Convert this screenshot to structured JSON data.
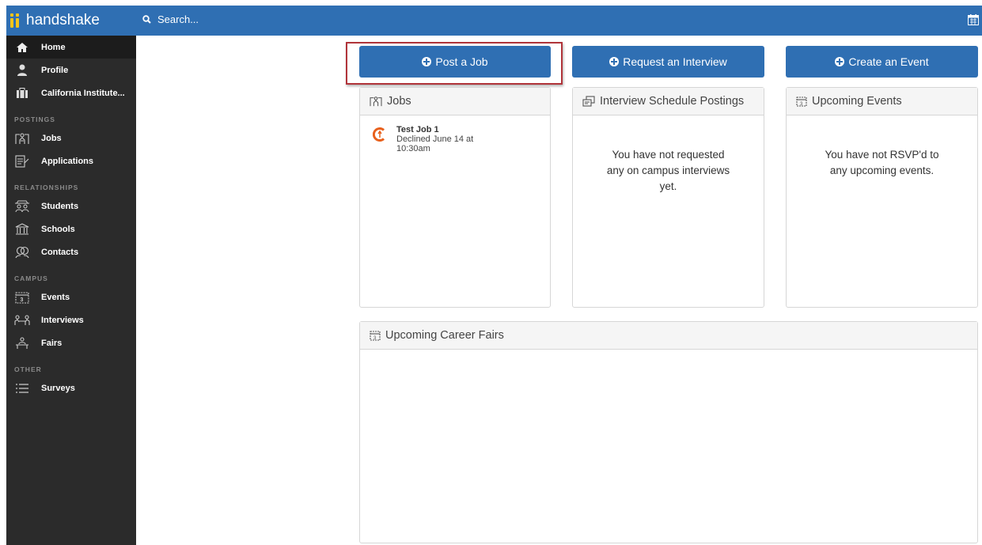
{
  "app": {
    "name": "handshake"
  },
  "search": {
    "placeholder": "Search..."
  },
  "sidebar": {
    "items_top": [
      {
        "label": "Home",
        "icon": "home-icon"
      },
      {
        "label": "Profile",
        "icon": "user-icon"
      },
      {
        "label": "California Institute...",
        "icon": "briefcase-icon"
      }
    ],
    "sections": {
      "postings": "POSTINGS",
      "relationships": "RELATIONSHIPS",
      "campus": "CAMPUS",
      "other": "OTHER"
    },
    "postings": [
      {
        "label": "Jobs",
        "icon": "jobs-icon"
      },
      {
        "label": "Applications",
        "icon": "applications-icon"
      }
    ],
    "relationships": [
      {
        "label": "Students",
        "icon": "students-icon"
      },
      {
        "label": "Schools",
        "icon": "school-icon"
      },
      {
        "label": "Contacts",
        "icon": "contacts-icon"
      }
    ],
    "campus": [
      {
        "label": "Events",
        "icon": "calendar-icon"
      },
      {
        "label": "Interviews",
        "icon": "interviews-icon"
      },
      {
        "label": "Fairs",
        "icon": "fairs-icon"
      }
    ],
    "other": [
      {
        "label": "Surveys",
        "icon": "surveys-icon"
      }
    ]
  },
  "actions": {
    "post_job": "Post a Job",
    "request_interview": "Request an Interview",
    "create_event": "Create an Event"
  },
  "cards": {
    "jobs": {
      "title": "Jobs",
      "job": {
        "title": "Test Job 1",
        "status": "Declined June 14 at 10:30am"
      }
    },
    "interviews": {
      "title": "Interview Schedule Postings",
      "empty_line1": "You have not requested",
      "empty_line2": "any on campus interviews",
      "empty_line3": "yet."
    },
    "events": {
      "title": "Upcoming Events",
      "empty_line1": "You have not RSVP'd to",
      "empty_line2": "any upcoming events."
    },
    "fairs": {
      "title": "Upcoming Career Fairs"
    }
  },
  "colors": {
    "brand_blue": "#2f6fb3",
    "sidebar_bg": "#2b2b2b",
    "logo_yellow": "#f5c518",
    "highlight_red": "#b0343a",
    "job_logo_orange": "#e8601c"
  }
}
